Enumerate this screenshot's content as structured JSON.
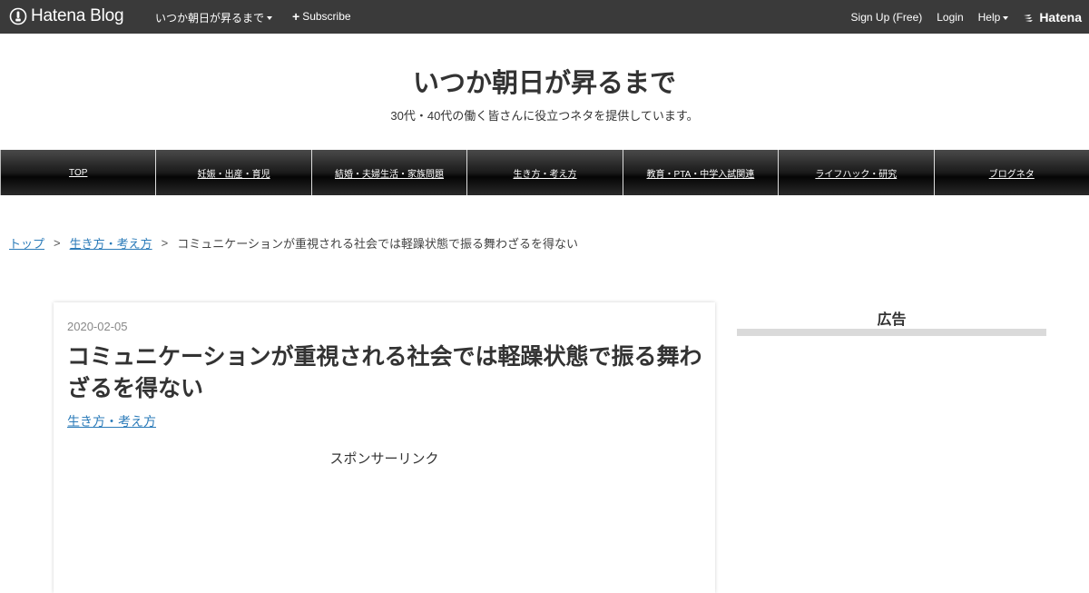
{
  "topbar": {
    "brand": "Hatena Blog",
    "blog_name": "いつか朝日が昇るまで",
    "subscribe": "Subscribe",
    "signup": "Sign Up (Free)",
    "login": "Login",
    "help": "Help",
    "hatena": "Hatena"
  },
  "header": {
    "title": "いつか朝日が昇るまで",
    "description": "30代・40代の働く皆さんに役立つネタを提供しています。"
  },
  "nav": {
    "items": [
      {
        "label": "TOP"
      },
      {
        "label": "妊娠・出産・育児"
      },
      {
        "label": "結婚・夫婦生活・家族問題"
      },
      {
        "label": "生き方・考え方"
      },
      {
        "label": "教育・PTA・中学入試関連"
      },
      {
        "label": "ライフハック・研究"
      },
      {
        "label": "ブログネタ"
      }
    ]
  },
  "breadcrumb": {
    "top": "トップ",
    "separator": ">",
    "category": "生き方・考え方",
    "current": "コミュニケーションが重視される社会では軽躁状態で振る舞わざるを得ない"
  },
  "article": {
    "date": "2020-02-05",
    "title": "コミュニケーションが重視される社会では軽躁状態で振る舞わざるを得ない",
    "category": "生き方・考え方",
    "sponsor": "スポンサーリンク"
  },
  "sidebar": {
    "heading": "広告"
  }
}
